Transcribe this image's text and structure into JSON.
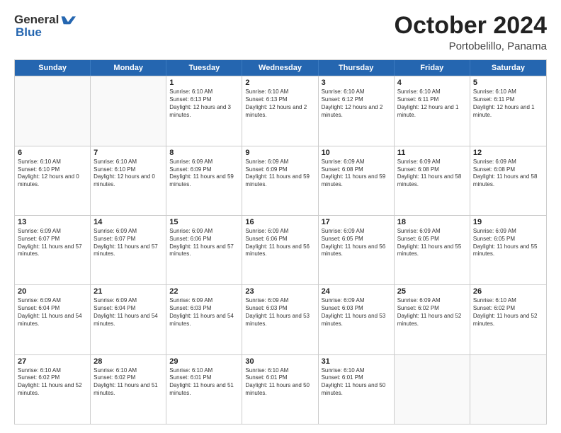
{
  "header": {
    "logo_general": "General",
    "logo_blue": "Blue",
    "month_title": "October 2024",
    "subtitle": "Portobelillo, Panama"
  },
  "weekdays": [
    "Sunday",
    "Monday",
    "Tuesday",
    "Wednesday",
    "Thursday",
    "Friday",
    "Saturday"
  ],
  "weeks": [
    [
      {
        "day": "",
        "empty": true
      },
      {
        "day": "",
        "empty": true
      },
      {
        "day": "1",
        "sunrise": "Sunrise: 6:10 AM",
        "sunset": "Sunset: 6:13 PM",
        "daylight": "Daylight: 12 hours and 3 minutes."
      },
      {
        "day": "2",
        "sunrise": "Sunrise: 6:10 AM",
        "sunset": "Sunset: 6:13 PM",
        "daylight": "Daylight: 12 hours and 2 minutes."
      },
      {
        "day": "3",
        "sunrise": "Sunrise: 6:10 AM",
        "sunset": "Sunset: 6:12 PM",
        "daylight": "Daylight: 12 hours and 2 minutes."
      },
      {
        "day": "4",
        "sunrise": "Sunrise: 6:10 AM",
        "sunset": "Sunset: 6:11 PM",
        "daylight": "Daylight: 12 hours and 1 minute."
      },
      {
        "day": "5",
        "sunrise": "Sunrise: 6:10 AM",
        "sunset": "Sunset: 6:11 PM",
        "daylight": "Daylight: 12 hours and 1 minute."
      }
    ],
    [
      {
        "day": "6",
        "sunrise": "Sunrise: 6:10 AM",
        "sunset": "Sunset: 6:10 PM",
        "daylight": "Daylight: 12 hours and 0 minutes."
      },
      {
        "day": "7",
        "sunrise": "Sunrise: 6:10 AM",
        "sunset": "Sunset: 6:10 PM",
        "daylight": "Daylight: 12 hours and 0 minutes."
      },
      {
        "day": "8",
        "sunrise": "Sunrise: 6:09 AM",
        "sunset": "Sunset: 6:09 PM",
        "daylight": "Daylight: 11 hours and 59 minutes."
      },
      {
        "day": "9",
        "sunrise": "Sunrise: 6:09 AM",
        "sunset": "Sunset: 6:09 PM",
        "daylight": "Daylight: 11 hours and 59 minutes."
      },
      {
        "day": "10",
        "sunrise": "Sunrise: 6:09 AM",
        "sunset": "Sunset: 6:08 PM",
        "daylight": "Daylight: 11 hours and 59 minutes."
      },
      {
        "day": "11",
        "sunrise": "Sunrise: 6:09 AM",
        "sunset": "Sunset: 6:08 PM",
        "daylight": "Daylight: 11 hours and 58 minutes."
      },
      {
        "day": "12",
        "sunrise": "Sunrise: 6:09 AM",
        "sunset": "Sunset: 6:08 PM",
        "daylight": "Daylight: 11 hours and 58 minutes."
      }
    ],
    [
      {
        "day": "13",
        "sunrise": "Sunrise: 6:09 AM",
        "sunset": "Sunset: 6:07 PM",
        "daylight": "Daylight: 11 hours and 57 minutes."
      },
      {
        "day": "14",
        "sunrise": "Sunrise: 6:09 AM",
        "sunset": "Sunset: 6:07 PM",
        "daylight": "Daylight: 11 hours and 57 minutes."
      },
      {
        "day": "15",
        "sunrise": "Sunrise: 6:09 AM",
        "sunset": "Sunset: 6:06 PM",
        "daylight": "Daylight: 11 hours and 57 minutes."
      },
      {
        "day": "16",
        "sunrise": "Sunrise: 6:09 AM",
        "sunset": "Sunset: 6:06 PM",
        "daylight": "Daylight: 11 hours and 56 minutes."
      },
      {
        "day": "17",
        "sunrise": "Sunrise: 6:09 AM",
        "sunset": "Sunset: 6:05 PM",
        "daylight": "Daylight: 11 hours and 56 minutes."
      },
      {
        "day": "18",
        "sunrise": "Sunrise: 6:09 AM",
        "sunset": "Sunset: 6:05 PM",
        "daylight": "Daylight: 11 hours and 55 minutes."
      },
      {
        "day": "19",
        "sunrise": "Sunrise: 6:09 AM",
        "sunset": "Sunset: 6:05 PM",
        "daylight": "Daylight: 11 hours and 55 minutes."
      }
    ],
    [
      {
        "day": "20",
        "sunrise": "Sunrise: 6:09 AM",
        "sunset": "Sunset: 6:04 PM",
        "daylight": "Daylight: 11 hours and 54 minutes."
      },
      {
        "day": "21",
        "sunrise": "Sunrise: 6:09 AM",
        "sunset": "Sunset: 6:04 PM",
        "daylight": "Daylight: 11 hours and 54 minutes."
      },
      {
        "day": "22",
        "sunrise": "Sunrise: 6:09 AM",
        "sunset": "Sunset: 6:03 PM",
        "daylight": "Daylight: 11 hours and 54 minutes."
      },
      {
        "day": "23",
        "sunrise": "Sunrise: 6:09 AM",
        "sunset": "Sunset: 6:03 PM",
        "daylight": "Daylight: 11 hours and 53 minutes."
      },
      {
        "day": "24",
        "sunrise": "Sunrise: 6:09 AM",
        "sunset": "Sunset: 6:03 PM",
        "daylight": "Daylight: 11 hours and 53 minutes."
      },
      {
        "day": "25",
        "sunrise": "Sunrise: 6:09 AM",
        "sunset": "Sunset: 6:02 PM",
        "daylight": "Daylight: 11 hours and 52 minutes."
      },
      {
        "day": "26",
        "sunrise": "Sunrise: 6:10 AM",
        "sunset": "Sunset: 6:02 PM",
        "daylight": "Daylight: 11 hours and 52 minutes."
      }
    ],
    [
      {
        "day": "27",
        "sunrise": "Sunrise: 6:10 AM",
        "sunset": "Sunset: 6:02 PM",
        "daylight": "Daylight: 11 hours and 52 minutes."
      },
      {
        "day": "28",
        "sunrise": "Sunrise: 6:10 AM",
        "sunset": "Sunset: 6:02 PM",
        "daylight": "Daylight: 11 hours and 51 minutes."
      },
      {
        "day": "29",
        "sunrise": "Sunrise: 6:10 AM",
        "sunset": "Sunset: 6:01 PM",
        "daylight": "Daylight: 11 hours and 51 minutes."
      },
      {
        "day": "30",
        "sunrise": "Sunrise: 6:10 AM",
        "sunset": "Sunset: 6:01 PM",
        "daylight": "Daylight: 11 hours and 50 minutes."
      },
      {
        "day": "31",
        "sunrise": "Sunrise: 6:10 AM",
        "sunset": "Sunset: 6:01 PM",
        "daylight": "Daylight: 11 hours and 50 minutes."
      },
      {
        "day": "",
        "empty": true
      },
      {
        "day": "",
        "empty": true
      }
    ]
  ]
}
